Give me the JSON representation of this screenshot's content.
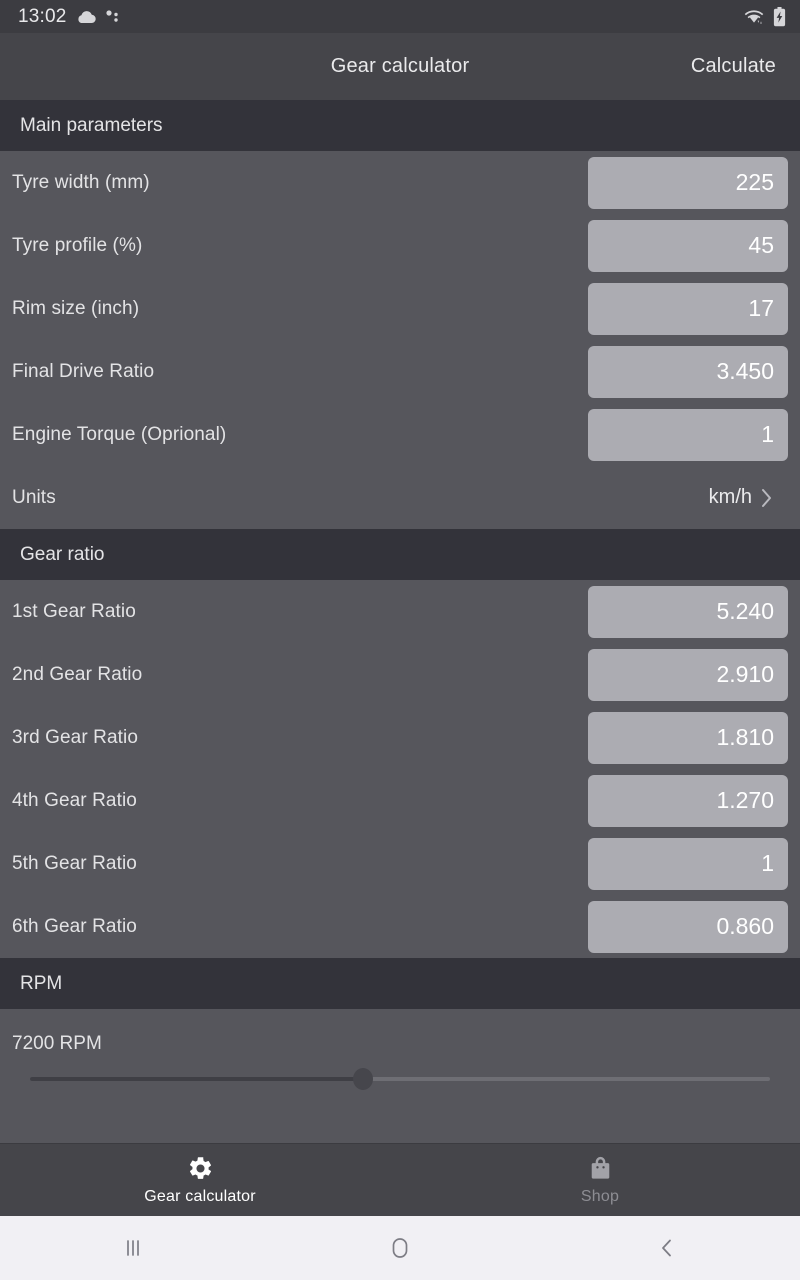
{
  "status_bar": {
    "time": "13:02",
    "icons": [
      "cloud-icon",
      "weather-dots-icon"
    ],
    "right_icons": [
      "wifi-icon",
      "battery-charging-icon"
    ]
  },
  "app_bar": {
    "title": "Gear calculator",
    "action_label": "Calculate"
  },
  "sections": {
    "main_parameters": {
      "header": "Main parameters",
      "rows": [
        {
          "label": "Tyre width (mm)",
          "value": "225"
        },
        {
          "label": "Tyre profile (%)",
          "value": "45"
        },
        {
          "label": "Rim size (inch)",
          "value": "17"
        },
        {
          "label": "Final Drive Ratio",
          "value": "3.450"
        },
        {
          "label": "Engine Torque (Oprional)",
          "value": "1"
        }
      ],
      "units_row": {
        "label": "Units",
        "value": "km/h",
        "chevron": "chevron-right-icon"
      }
    },
    "gear_ratio": {
      "header": "Gear ratio",
      "rows": [
        {
          "label": "1st Gear Ratio",
          "value": "5.240"
        },
        {
          "label": "2nd Gear Ratio",
          "value": "2.910"
        },
        {
          "label": "3rd Gear Ratio",
          "value": "1.810"
        },
        {
          "label": "4th Gear Ratio",
          "value": "1.270"
        },
        {
          "label": "5th Gear Ratio",
          "value": "1"
        },
        {
          "label": "6th Gear Ratio",
          "value": "0.860"
        }
      ]
    },
    "rpm": {
      "header": "RPM",
      "value_text": "7200 RPM",
      "slider_percent": 45
    }
  },
  "tab_bar": {
    "tabs": [
      {
        "label": "Gear calculator",
        "icon": "gear-icon",
        "active": true
      },
      {
        "label": "Shop",
        "icon": "shopping-bag-icon",
        "active": false
      }
    ]
  },
  "nav_bar": {
    "buttons": [
      "recents-icon",
      "home-icon",
      "back-icon"
    ]
  },
  "colors": {
    "page_bg": "#56565c",
    "section_header_bg": "#33333a",
    "app_bar_bg": "#45454a",
    "field_bg": "#acacb2",
    "nav_bar_bg": "#f1f0f4"
  }
}
